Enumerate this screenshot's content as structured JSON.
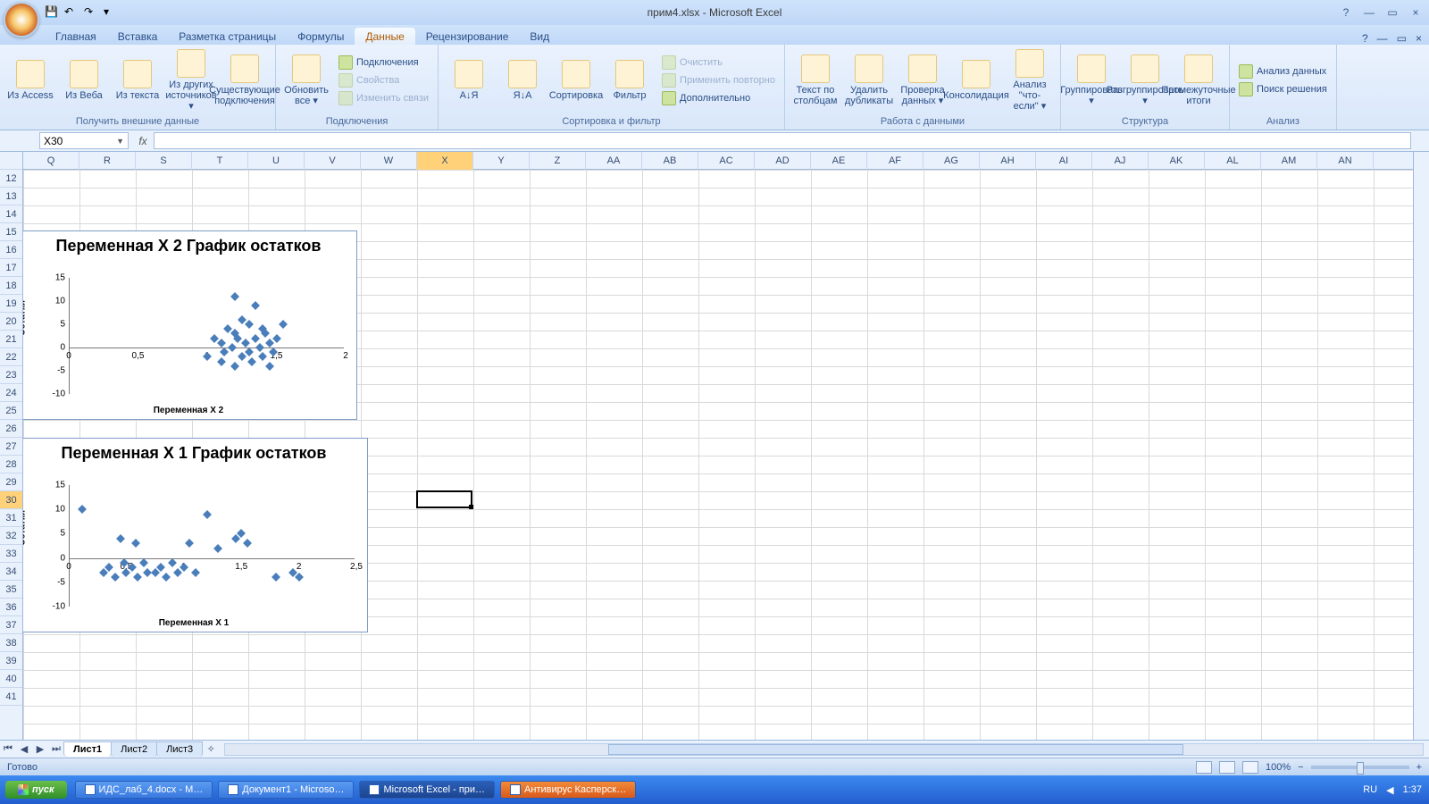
{
  "title": "прим4.xlsx - Microsoft Excel",
  "qat": {
    "save": "💾",
    "undo": "↶",
    "redo": "↷"
  },
  "tabs": {
    "items": [
      "Главная",
      "Вставка",
      "Разметка страницы",
      "Формулы",
      "Данные",
      "Рецензирование",
      "Вид"
    ],
    "active_index": 4
  },
  "ribbon": {
    "groups": [
      {
        "label": "Получить внешние данные",
        "big": [
          {
            "label": "Из Access"
          },
          {
            "label": "Из Веба"
          },
          {
            "label": "Из текста"
          },
          {
            "label": "Из других источников ▾"
          },
          {
            "label": "Существующие подключения"
          }
        ]
      },
      {
        "label": "Подключения",
        "big": [
          {
            "label": "Обновить все ▾"
          }
        ],
        "small": [
          {
            "label": "Подключения",
            "dim": false
          },
          {
            "label": "Свойства",
            "dim": true
          },
          {
            "label": "Изменить связи",
            "dim": true
          }
        ]
      },
      {
        "label": "Сортировка и фильтр",
        "big": [
          {
            "label": "А↓Я"
          },
          {
            "label": "Я↓А"
          },
          {
            "label": "Сортировка"
          },
          {
            "label": "Фильтр"
          }
        ],
        "small": [
          {
            "label": "Очистить",
            "dim": true
          },
          {
            "label": "Применить повторно",
            "dim": true
          },
          {
            "label": "Дополнительно",
            "dim": false
          }
        ]
      },
      {
        "label": "Работа с данными",
        "big": [
          {
            "label": "Текст по столбцам"
          },
          {
            "label": "Удалить дубликаты"
          },
          {
            "label": "Проверка данных ▾"
          },
          {
            "label": "Консолидация"
          },
          {
            "label": "Анализ \"что-если\" ▾"
          }
        ]
      },
      {
        "label": "Структура",
        "big": [
          {
            "label": "Группировать ▾"
          },
          {
            "label": "Разгруппировать ▾"
          },
          {
            "label": "Промежуточные итоги"
          }
        ]
      },
      {
        "label": "Анализ",
        "small": [
          {
            "label": "Анализ данных"
          },
          {
            "label": "Поиск решения"
          }
        ]
      }
    ]
  },
  "namebox": "X30",
  "formula": "",
  "columns": [
    "Q",
    "R",
    "S",
    "T",
    "U",
    "V",
    "W",
    "X",
    "Y",
    "Z",
    "AA",
    "AB",
    "AC",
    "AD",
    "AE",
    "AF",
    "AG",
    "AH",
    "AI",
    "AJ",
    "AK",
    "AL",
    "AM",
    "AN"
  ],
  "selected_col": "X",
  "rows_start": 12,
  "rows_end": 41,
  "selected_row": 30,
  "chart_data": [
    {
      "type": "scatter",
      "title": "Переменная X 2 График остатков",
      "xlabel": "Переменная X 2",
      "ylabel": "Остатки",
      "xlim": [
        0,
        2
      ],
      "ylim": [
        -10,
        15
      ],
      "xticks": [
        0,
        0.5,
        1,
        1.5,
        2
      ],
      "xtick_labels": [
        "0",
        "0,5",
        "1",
        "1,5",
        "2"
      ],
      "yticks": [
        -10,
        -5,
        0,
        5,
        10,
        15
      ],
      "series": [
        {
          "name": "Остатки",
          "points": [
            [
              1.0,
              -2
            ],
            [
              1.05,
              2
            ],
            [
              1.1,
              -3
            ],
            [
              1.1,
              1
            ],
            [
              1.12,
              -1
            ],
            [
              1.15,
              4
            ],
            [
              1.18,
              0
            ],
            [
              1.2,
              -4
            ],
            [
              1.2,
              3
            ],
            [
              1.22,
              2
            ],
            [
              1.25,
              -2
            ],
            [
              1.25,
              6
            ],
            [
              1.28,
              1
            ],
            [
              1.3,
              -1
            ],
            [
              1.3,
              5
            ],
            [
              1.32,
              -3
            ],
            [
              1.35,
              2
            ],
            [
              1.35,
              9
            ],
            [
              1.38,
              0
            ],
            [
              1.4,
              -2
            ],
            [
              1.4,
              4
            ],
            [
              1.42,
              3
            ],
            [
              1.45,
              -4
            ],
            [
              1.45,
              1
            ],
            [
              1.48,
              -1
            ],
            [
              1.5,
              2
            ],
            [
              1.55,
              5
            ],
            [
              1.2,
              11
            ]
          ]
        }
      ]
    },
    {
      "type": "scatter",
      "title": "Переменная X 1 График остатков",
      "xlabel": "Переменная X 1",
      "ylabel": "Остатки",
      "xlim": [
        0,
        2.5
      ],
      "ylim": [
        -10,
        15
      ],
      "xticks": [
        0,
        0.5,
        1,
        1.5,
        2,
        2.5
      ],
      "xtick_labels": [
        "0",
        "0,5",
        "1",
        "1,5",
        "2",
        "2,5"
      ],
      "yticks": [
        -10,
        -5,
        0,
        5,
        10,
        15
      ],
      "series": [
        {
          "name": "Остатки",
          "points": [
            [
              0.12,
              10
            ],
            [
              0.3,
              -3
            ],
            [
              0.35,
              -2
            ],
            [
              0.4,
              -4
            ],
            [
              0.45,
              4
            ],
            [
              0.48,
              -1
            ],
            [
              0.5,
              -3
            ],
            [
              0.55,
              -2
            ],
            [
              0.58,
              3
            ],
            [
              0.6,
              -4
            ],
            [
              0.65,
              -1
            ],
            [
              0.68,
              -3
            ],
            [
              0.75,
              -3
            ],
            [
              0.8,
              -2
            ],
            [
              0.85,
              -4
            ],
            [
              0.9,
              -1
            ],
            [
              0.95,
              -3
            ],
            [
              1.0,
              -2
            ],
            [
              1.05,
              3
            ],
            [
              1.1,
              -3
            ],
            [
              1.2,
              9
            ],
            [
              1.3,
              2
            ],
            [
              1.45,
              4
            ],
            [
              1.5,
              5
            ],
            [
              1.55,
              3
            ],
            [
              1.8,
              -4
            ],
            [
              1.95,
              -3
            ],
            [
              2.0,
              -4
            ]
          ]
        }
      ]
    }
  ],
  "sheets": {
    "items": [
      "Лист1",
      "Лист2",
      "Лист3"
    ],
    "active_index": 0
  },
  "status": {
    "ready": "Готово",
    "zoom": "100%"
  },
  "taskbar": {
    "start": "пуск",
    "items": [
      {
        "label": "ИДС_лаб_4.docx - M…"
      },
      {
        "label": "Документ1 - Microso…"
      },
      {
        "label": "Microsoft Excel - при…",
        "active": true
      },
      {
        "label": "Антивирус Касперск…",
        "alert": true
      }
    ],
    "lang": "RU",
    "time": "1:37"
  }
}
